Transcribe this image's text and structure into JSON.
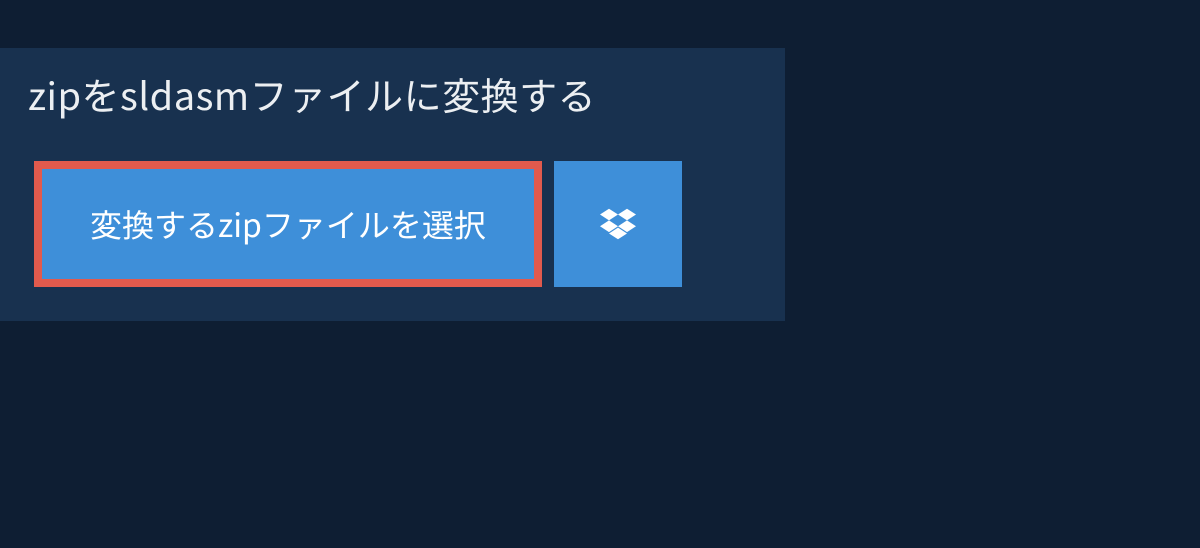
{
  "heading": "zipをsldasmファイルに変換する",
  "select_button_label": "変換するzipファイルを選択",
  "icons": {
    "dropbox": "dropbox-icon"
  },
  "colors": {
    "page_bg": "#0e1e33",
    "panel_bg": "#18314f",
    "button_bg": "#3e8fd9",
    "button_border": "#e15a4d",
    "text_light": "#eceff2",
    "text_white": "#ffffff"
  }
}
